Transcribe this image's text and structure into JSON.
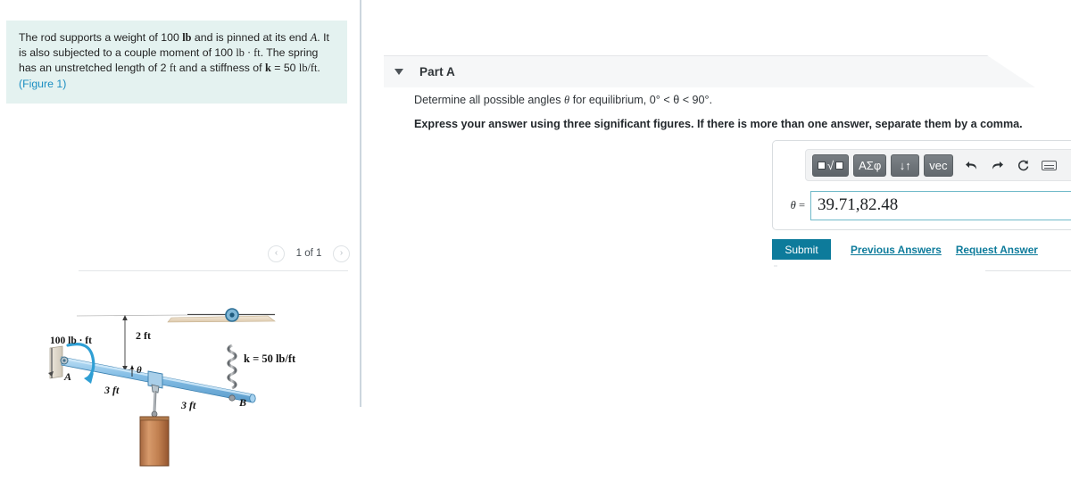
{
  "problem": {
    "text_parts": [
      "The rod supports a weight of 100 ",
      "lb",
      " and is pinned at its end ",
      "A",
      ". It is also subjected to a couple moment of 100 ",
      "lb · ft",
      ". The spring has an unstretched length of 2 ",
      "ft",
      " and a stiffness of ",
      "k",
      " = 50 ",
      "lb/ft",
      ". ",
      "(Figure 1)"
    ],
    "figure_link": "(Figure 1)"
  },
  "pager": {
    "label": "1 of 1",
    "prev_icon": "chevron-left-icon",
    "next_icon": "chevron-right-icon",
    "prev_glyph": "‹",
    "next_glyph": "›"
  },
  "figure": {
    "caption_moment": "100 lb · ft",
    "label_a": "A",
    "label_b": "B",
    "dim_vertical": "2 ft",
    "dim_left": "3 ft",
    "dim_right": "3 ft",
    "theta": "θ",
    "spring_label": "k = 50 lb/ft",
    "colors": {
      "rod": "#8fc4e8",
      "rod_dark": "#5f9fd0",
      "weight": "#c08457",
      "ceiling": "#e8d9c3",
      "pin": "#2f7fa8"
    }
  },
  "part": {
    "title": "Part A",
    "caret_icon": "caret-down-icon",
    "prompt_prefix": "Determine all possible angles ",
    "prompt_theta": "θ",
    "prompt_middle": " for equilibrium, ",
    "prompt_range": "0° < θ < 90°",
    "prompt_suffix": ".",
    "instruction": "Express your answer using three significant figures. If there is more than one answer, separate them by a comma."
  },
  "mathbar": {
    "buttons": [
      {
        "name": "template-button",
        "label": "template"
      },
      {
        "name": "greek-symbols-button",
        "label": "ΑΣφ"
      },
      {
        "name": "sort-button",
        "label": "↓↑"
      },
      {
        "name": "vector-button",
        "label": "vec"
      }
    ],
    "radical_glyph": "√",
    "greek_label": "ΑΣφ",
    "sort_label": "↓↑",
    "vec_label": "vec",
    "undo_glyph": "↰",
    "redo_glyph": "↱",
    "reset_glyph": "↻",
    "keyboard_icon": "keyboard-icon",
    "help_glyph": "?"
  },
  "answer": {
    "variable": "θ",
    "equals": "=",
    "value": "39.71,82.48",
    "placeholder": "",
    "unit": "°"
  },
  "actions": {
    "submit": "Submit",
    "previous_answers": "Previous Answers",
    "request_answer": "Request Answer"
  },
  "colors": {
    "accent_teal": "#0d7b9b",
    "problem_bg": "#e4f2f0",
    "header_bg": "#f6f7f8",
    "input_border": "#6fb9c9"
  }
}
